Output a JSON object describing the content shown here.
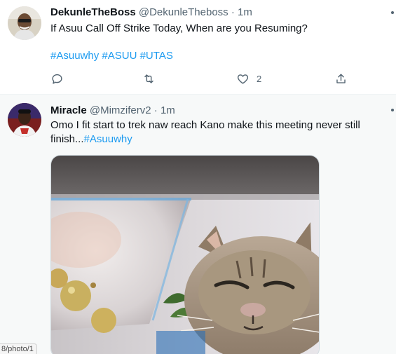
{
  "tweets": [
    {
      "display_name": "DekunleTheBoss",
      "handle": "@DekunleTheboss",
      "separator": "·",
      "time": "1m",
      "text": "If Asuu Call Off Strike Today, When are you Resuming?",
      "hashtags": [
        "#Asuuwhy",
        "#ASUU",
        "#UTAS"
      ],
      "actions": {
        "reply_icon": "reply-icon",
        "retweet_icon": "retweet-icon",
        "like_icon": "heart-icon",
        "like_count": "2",
        "share_icon": "share-icon"
      }
    },
    {
      "display_name": "Miracle",
      "handle": "@Mimziferv2",
      "separator": "·",
      "time": "1m",
      "text": "Omo I fit start to  trek naw reach Kano make this meeting never still finish...",
      "hashtag": "#Asuuwhy",
      "media_icon": "photo-cat-martini"
    }
  ],
  "status_url": "8/photo/1",
  "colors": {
    "link": "#1d9bf0",
    "secondary_text": "#536471",
    "hover_background": "#f7f9f9"
  }
}
